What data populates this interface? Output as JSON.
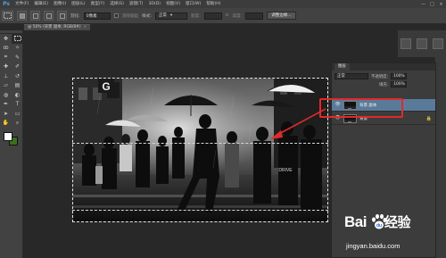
{
  "app": {
    "logo": "Ps",
    "menu": [
      "文件(F)",
      "编辑(E)",
      "图像(I)",
      "图层(L)",
      "类型(Y)",
      "选择(S)",
      "滤镜(T)",
      "3D(D)",
      "视图(V)",
      "窗口(W)",
      "帮助(H)"
    ],
    "window_controls": [
      "—",
      "□",
      "×"
    ]
  },
  "options_bar": {
    "feather_label": "羽化:",
    "feather_value": "0像素",
    "antialias_label": "消除锯齿",
    "style_label": "样式:",
    "style_value": "正常",
    "width_label": "宽度:",
    "height_label": "高度:",
    "refine_edge_label": "调整边缘..."
  },
  "document": {
    "tab_title": "@ 50% (背景 副本, RGB/8#)",
    "close": "×"
  },
  "layers_panel": {
    "tab_label": "图层",
    "blend_mode": "正常",
    "opacity_label": "不透明度:",
    "opacity_value": "100%",
    "fill_label": "填充:",
    "fill_value": "100%",
    "layers": [
      {
        "name": "背景 副本",
        "selected": true,
        "visible": true
      },
      {
        "name": "背景",
        "selected": false,
        "visible": true,
        "locked": true
      }
    ]
  },
  "photo": {
    "sign_letter": "G",
    "shop_text": "DRIVE"
  },
  "colors": {
    "foreground": "#ffffff",
    "background": "#3b6e1e",
    "highlight": "#e02a2a"
  },
  "icons": [
    "move-icon",
    "marquee-icon",
    "lasso-icon",
    "magic-wand-icon",
    "crop-icon",
    "eyedropper-icon",
    "healing-icon",
    "brush-icon",
    "stamp-icon",
    "history-brush-icon",
    "eraser-icon",
    "gradient-icon",
    "blur-icon",
    "dodge-icon",
    "pen-icon",
    "type-icon",
    "path-select-icon",
    "shape-icon",
    "hand-icon",
    "zoom-icon",
    "eye-icon",
    "lock-icon"
  ],
  "watermark": {
    "brand": "Bai",
    "brand2": "经验",
    "url": "jingyan.baidu.com"
  }
}
